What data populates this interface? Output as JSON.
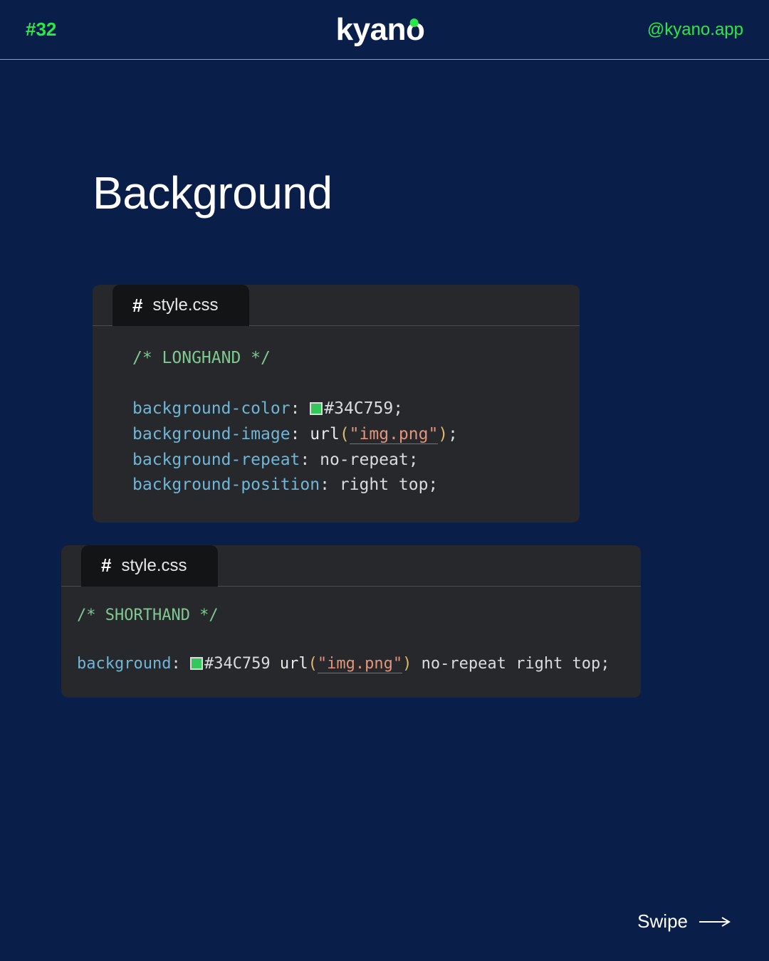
{
  "header": {
    "slide_number": "#32",
    "logo_text": "kyano",
    "handle": "@kyano.app"
  },
  "title": "Background",
  "colors": {
    "accent": "#2de64a",
    "swatch": "#34C759",
    "bg": "#0a1e4a",
    "code_bg": "#26282b"
  },
  "blocks": [
    {
      "filename": "style.css",
      "comment": "/* LONGHAND */",
      "lines": [
        [
          {
            "cls": "c-prop",
            "t": "background-color"
          },
          {
            "cls": "c-plain",
            "t": ": "
          },
          {
            "swatch": true
          },
          {
            "cls": "c-plain",
            "t": "#34C759;"
          }
        ],
        [
          {
            "cls": "c-prop",
            "t": "background-image"
          },
          {
            "cls": "c-plain",
            "t": ": "
          },
          {
            "cls": "c-url",
            "t": "url"
          },
          {
            "cls": "c-paren",
            "t": "("
          },
          {
            "cls": "c-str",
            "t": "\"img.png\""
          },
          {
            "cls": "c-paren",
            "t": ")"
          },
          {
            "cls": "c-plain",
            "t": ";"
          }
        ],
        [
          {
            "cls": "c-prop",
            "t": "background-repeat"
          },
          {
            "cls": "c-plain",
            "t": ": no-repeat;"
          }
        ],
        [
          {
            "cls": "c-prop",
            "t": "background-position"
          },
          {
            "cls": "c-plain",
            "t": ": right top;"
          }
        ]
      ]
    },
    {
      "filename": "style.css",
      "comment": "/* SHORTHAND */",
      "lines": [
        [
          {
            "cls": "c-prop",
            "t": "background"
          },
          {
            "cls": "c-plain",
            "t": ": "
          },
          {
            "swatch": true
          },
          {
            "cls": "c-plain",
            "t": "#34C759 "
          },
          {
            "cls": "c-url",
            "t": "url"
          },
          {
            "cls": "c-paren",
            "t": "("
          },
          {
            "cls": "c-str",
            "t": "\"img.png\""
          },
          {
            "cls": "c-paren",
            "t": ")"
          },
          {
            "cls": "c-plain",
            "t": " no-repeat right top;"
          }
        ]
      ]
    }
  ],
  "footer": {
    "swipe": "Swipe"
  }
}
